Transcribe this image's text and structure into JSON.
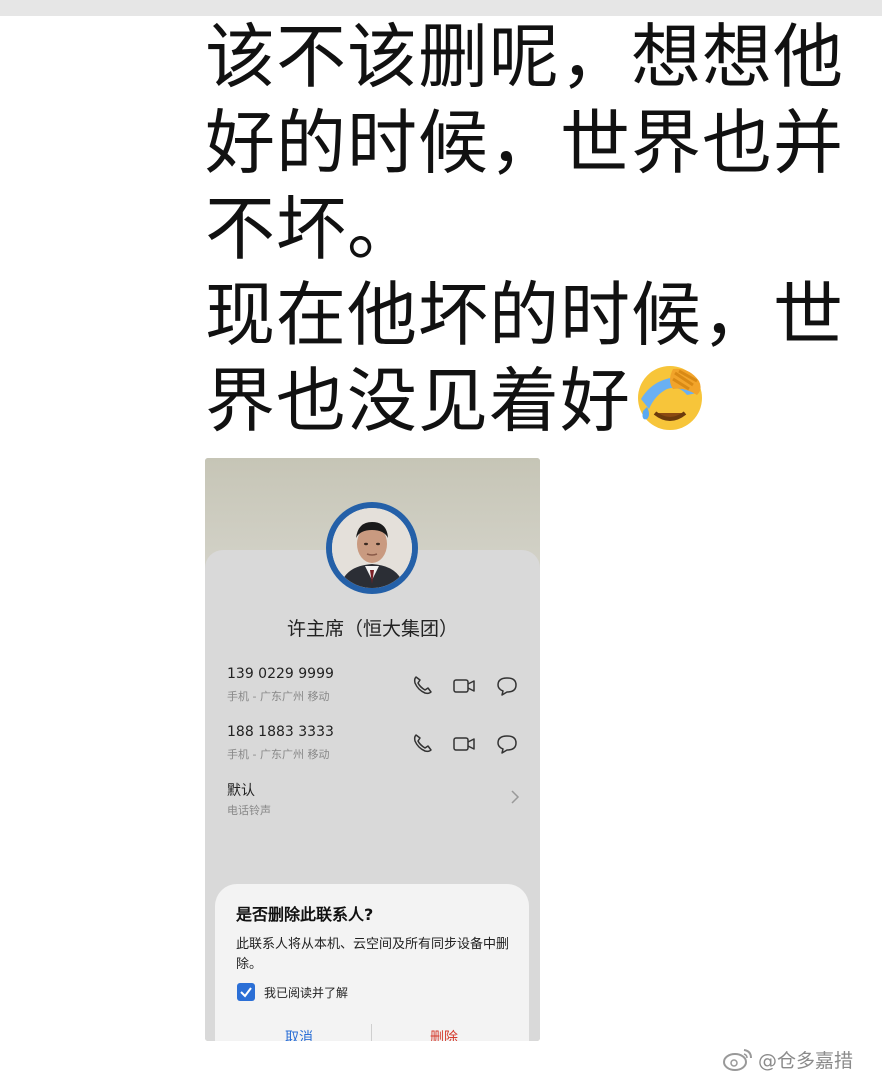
{
  "post": {
    "lines": [
      "该不该删呢，想想他",
      "好的时候，世界也并",
      "不坏。",
      "现在他坏的时候，世",
      "界也没见着好"
    ],
    "emoji": "facepalm-crying-emoji"
  },
  "contact": {
    "name": "许主席（恒大集团）",
    "phones": [
      {
        "number": "139 0229 9999",
        "detail": "手机 - 广东广州 移动"
      },
      {
        "number": "188 1883 3333",
        "detail": "手机 - 广东广州 移动"
      }
    ],
    "ringtone": {
      "title": "默认",
      "subtitle": "电话铃声"
    },
    "icons": [
      "phone-icon",
      "video-call-icon",
      "message-icon"
    ]
  },
  "dialog": {
    "title": "是否删除此联系人?",
    "body": "此联系人将从本机、云空间及所有同步设备中删除。",
    "checkbox_label": "我已阅读并了解",
    "checkbox_checked": true,
    "cancel_label": "取消",
    "delete_label": "删除"
  },
  "watermark": {
    "text": "@仓多嘉措"
  },
  "colors": {
    "accent_blue": "#2b6fd6",
    "delete_red": "#d43a2c",
    "avatar_ring": "#2460a8"
  }
}
